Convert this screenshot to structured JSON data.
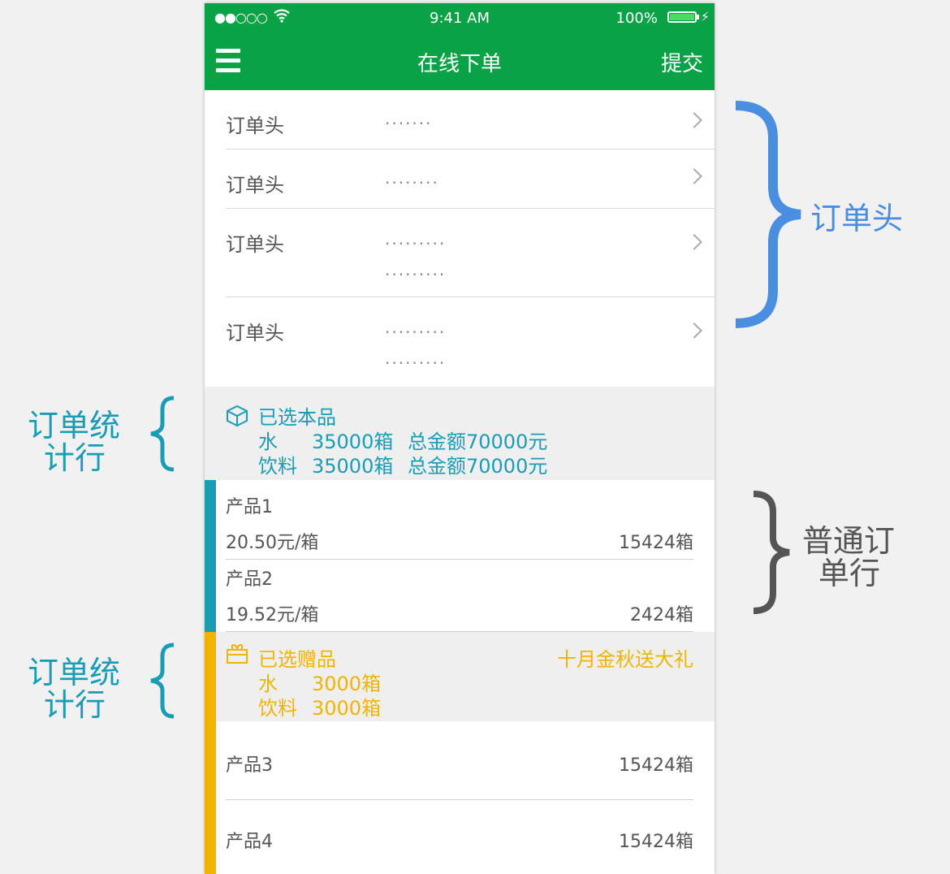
{
  "colors": {
    "header_green": "#0aa246",
    "teal": "#1a9db4",
    "gold": "#f0b400",
    "brace_blue": "#4a8ee0",
    "brace_gray": "#555555"
  },
  "status_bar": {
    "signal": "●●○○○",
    "wifi_icon": "wifi-icon",
    "time": "9:41 AM",
    "battery": "100%",
    "battery_fill": 1.0,
    "charging_icon": "bolt-icon"
  },
  "navbar": {
    "menu_icon": "menu-icon",
    "title": "在线下单",
    "submit": "提交"
  },
  "order_head_rows": [
    {
      "label": "订单头",
      "dots": [
        "·······"
      ]
    },
    {
      "label": "订单头",
      "dots": [
        "········"
      ]
    },
    {
      "label": "订单头",
      "dots": [
        "·········",
        "·········"
      ]
    },
    {
      "label": "订单头",
      "dots": [
        "·········",
        "·········"
      ]
    }
  ],
  "selected_products": {
    "icon": "box-icon",
    "title": "已选本品",
    "lines": [
      {
        "name": "水",
        "qty": "35000箱",
        "amount": "总金额70000元"
      },
      {
        "name": "饮料",
        "qty": "35000箱",
        "amount": "总金额70000元"
      }
    ]
  },
  "product_rows": [
    {
      "name": "产品1",
      "price": "20.50元/箱",
      "qty": "15424箱"
    },
    {
      "name": "产品2",
      "price": "19.52元/箱",
      "qty": "2424箱"
    }
  ],
  "selected_gifts": {
    "icon": "gift-icon",
    "title": "已选赠品",
    "promo": "十月金秋送大礼",
    "lines": [
      {
        "name": "水",
        "qty": "3000箱"
      },
      {
        "name": "饮料",
        "qty": "3000箱"
      }
    ]
  },
  "gift_rows": [
    {
      "name": "产品3",
      "qty": "15424箱"
    },
    {
      "name": "产品4",
      "qty": "15424箱"
    }
  ],
  "annotations": {
    "order_head": "订单头",
    "summary_line_1": {
      "line1": "订单统",
      "line2": "计行"
    },
    "summary_line_2": {
      "line1": "订单统",
      "line2": "计行"
    },
    "normal_line": {
      "line1": "普通订",
      "line2": "单行"
    }
  }
}
